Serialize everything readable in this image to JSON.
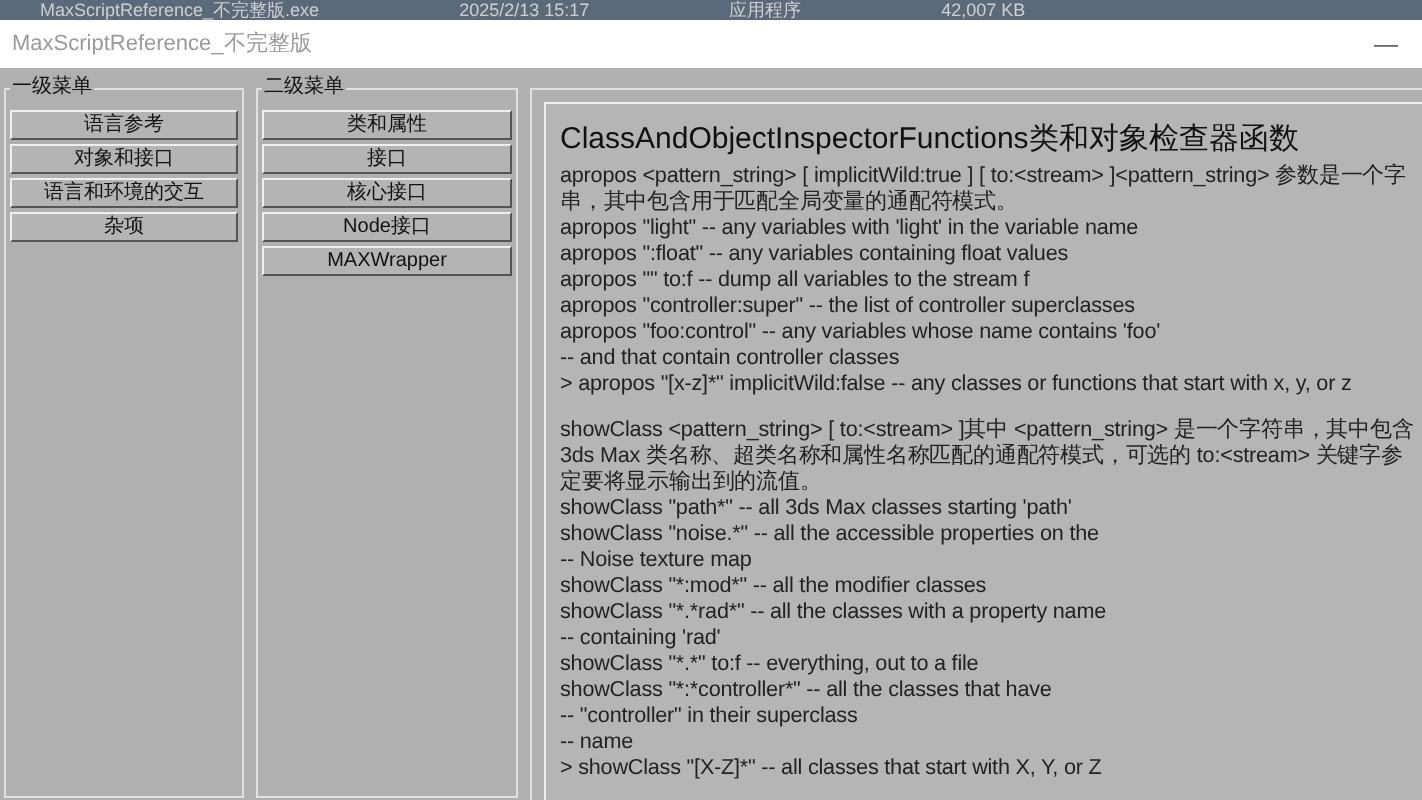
{
  "file_row": {
    "name": "MaxScriptReference_不完整版.exe",
    "date": "2025/2/13 15:17",
    "type": "应用程序",
    "size": "42,007 KB"
  },
  "window": {
    "title": "MaxScriptReference_不完整版",
    "minimize": "—"
  },
  "menu_1": {
    "title": "一级菜单",
    "items": [
      {
        "label": "语言参考"
      },
      {
        "label": "对象和接口"
      },
      {
        "label": "语言和环境的交互"
      },
      {
        "label": "杂项"
      }
    ]
  },
  "menu_2": {
    "title": "二级菜单",
    "items": [
      {
        "label": "类和属性"
      },
      {
        "label": "接口"
      },
      {
        "label": "核心接口"
      },
      {
        "label": "Node接口"
      },
      {
        "label": "MAXWrapper"
      }
    ]
  },
  "content": {
    "heading": "ClassAndObjectInspectorFunctions类和对象检查器函数",
    "paragraphs": [
      [
        "apropos <pattern_string> [ implicitWild:true ] [ to:<stream> ]<pattern_string> 参数是一个字",
        "串，其中包含用于匹配全局变量的通配符模式。",
        "apropos \"light\" -- any variables with 'light' in the variable name",
        "apropos \":float\" -- any variables containing float values",
        "apropos \"\" to:f -- dump all variables to the stream f",
        "apropos \"controller:super\" -- the list of controller superclasses",
        "apropos \"foo:control\" -- any variables whose name contains 'foo'",
        "-- and that contain controller classes",
        ">   apropos \"[x-z]*\" implicitWild:false -- any classes or functions that start with x, y, or z"
      ],
      [
        "showClass <pattern_string> [ to:<stream> ]其中 <pattern_string> 是一个字符串，其中包含",
        "3ds Max 类名称、超类名称和属性名称匹配的通配符模式，可选的 to:<stream> 关键字参",
        "定要将显示输出到的流值。",
        "showClass \"path*\" -- all 3ds Max classes starting 'path'",
        "showClass \"noise.*\" -- all the accessible properties on the",
        "-- Noise texture map",
        "showClass \"*:mod*\" -- all the modifier classes",
        "showClass \"*.*rad*\" -- all the classes with a property name",
        "-- containing 'rad'",
        "showClass \"*.*\" to:f -- everything, out to a file",
        "showClass \"*:*controller*\" -- all the classes that have",
        "-- \"controller\" in their superclass",
        "-- name",
        ">   showClass \"[X-Z]*\" -- all classes that start with X, Y, or Z"
      ]
    ]
  }
}
